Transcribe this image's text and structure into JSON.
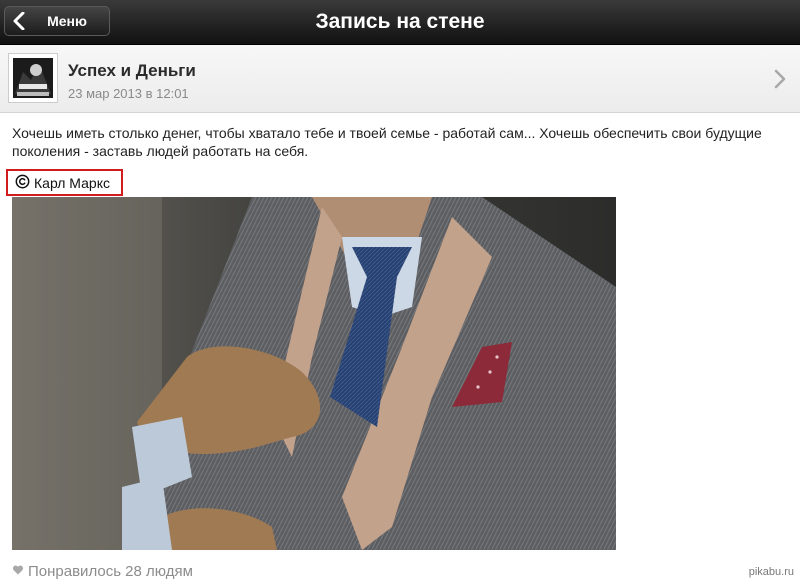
{
  "nav": {
    "back_label": "Меню",
    "title": "Запись на стене"
  },
  "post": {
    "group_name": "Успех и Деньги",
    "date": "23 мар 2013 в 12:01",
    "text": "Хочешь иметь столько денег, чтобы хватало тебе и твоей семье - работай сам... Хочешь обеспечить свои будущие поколения - заставь людей работать на себя.",
    "quote_author": "Карл Маркс",
    "likes": "Понравилось 28 людям"
  },
  "watermark": "pikabu.ru",
  "colors": {
    "highlight_border": "#d01c1c",
    "topbar": "#1a1a1a"
  },
  "icons": {
    "back": "chevron-left-icon",
    "open": "chevron-right-icon",
    "copyright": "copyright-icon",
    "like": "heart-icon"
  }
}
